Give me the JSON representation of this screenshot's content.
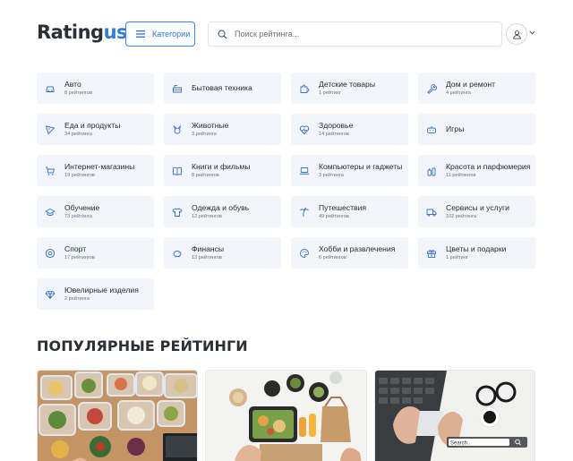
{
  "header": {
    "logo_main": "Rating",
    "logo_accent": "us",
    "categories_label": "Категории",
    "search_placeholder": "Поиск рейтинга..."
  },
  "categories": [
    {
      "name": "Авто",
      "count": "8 рейтингов",
      "icon": "car-icon"
    },
    {
      "name": "Бытовая техника",
      "count": "",
      "icon": "appliance-icon"
    },
    {
      "name": "Детские товары",
      "count": "1 рейтинг",
      "icon": "puzzle-icon"
    },
    {
      "name": "Дом и ремонт",
      "count": "4 рейтинга",
      "icon": "wrench-icon"
    },
    {
      "name": "Еда и продукты",
      "count": "34 рейтинга",
      "icon": "pizza-slice-icon"
    },
    {
      "name": "Животные",
      "count": "3 рейтинга",
      "icon": "pet-icon"
    },
    {
      "name": "Здоровье",
      "count": "14 рейтингов",
      "icon": "heart-pulse-icon"
    },
    {
      "name": "Игры",
      "count": "",
      "icon": "gamepad-icon"
    },
    {
      "name": "Интернет-магазины",
      "count": "19 рейтингов",
      "icon": "cart-icon"
    },
    {
      "name": "Книги и фильмы",
      "count": "8 рейтингов",
      "icon": "book-icon"
    },
    {
      "name": "Компьютеры и гаджеты",
      "count": "3 рейтинга",
      "icon": "laptop-icon"
    },
    {
      "name": "Красота и парфюмерия",
      "count": "11 рейтингов",
      "icon": "perfume-icon"
    },
    {
      "name": "Обучение",
      "count": "73 рейтинга",
      "icon": "graduation-cap-icon"
    },
    {
      "name": "Одежда и обувь",
      "count": "12 рейтингов",
      "icon": "tshirt-icon"
    },
    {
      "name": "Путешествия",
      "count": "49 рейтингов",
      "icon": "palm-tree-icon"
    },
    {
      "name": "Сервисы и услуги",
      "count": "102 рейтинга",
      "icon": "truck-icon"
    },
    {
      "name": "Спорт",
      "count": "17 рейтингов",
      "icon": "ball-icon"
    },
    {
      "name": "Финансы",
      "count": "13 рейтингов",
      "icon": "piggy-bank-icon"
    },
    {
      "name": "Хобби и развлечения",
      "count": "6 рейтингов",
      "icon": "palette-icon"
    },
    {
      "name": "Цветы и подарки",
      "count": "1 рейтинг",
      "icon": "gift-icon"
    },
    {
      "name": "Ювелирные изделия",
      "count": "2 рейтинга",
      "icon": "diamond-icon"
    }
  ],
  "popular": {
    "title": "ПОПУЛЯРНЫЕ РЕЙТИНГИ",
    "cards": [
      {
        "image": "meal-prep-containers-photo"
      },
      {
        "image": "food-delivery-box-photo"
      },
      {
        "image": "laptop-typing-photo",
        "search_text": "Search.."
      }
    ]
  },
  "colors": {
    "accent": "#2f7bdc",
    "tile_bg": "#f2f5f9",
    "icon": "#3b6fc9"
  }
}
